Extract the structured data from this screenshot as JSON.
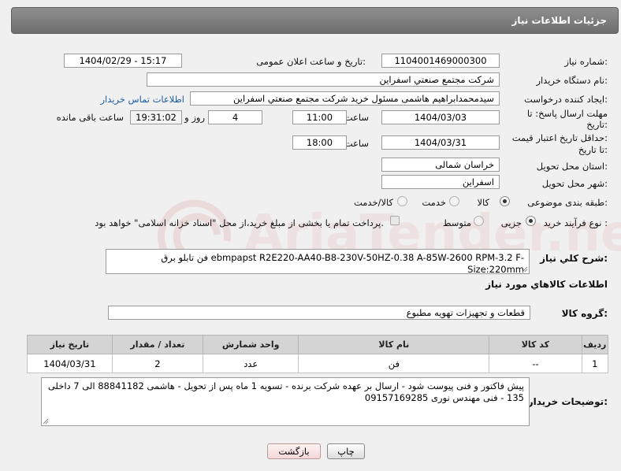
{
  "header": {
    "title": "جزئیات اطلاعات نیاز"
  },
  "need_number": {
    "label": "شماره نیاز:",
    "value": "1104001469000300"
  },
  "announce_datetime": {
    "label": "تاریخ و ساعت اعلان عمومی:",
    "value": "1404/02/29 - 15:17"
  },
  "buyer_org": {
    "label": "نام دستگاه خریدار:",
    "value": "شرکت مجتمع صنعتي اسفراين"
  },
  "requester": {
    "label": "ایجاد کننده درخواست:",
    "value": "سیدمحمدابراهیم هاشمی مسئول خرید شرکت مجتمع صنعتي اسفراين",
    "contact_link": "اطلاعات تماس خریدار"
  },
  "reply_deadline": {
    "label_line1": "مهلت ارسال پاسخ: تا",
    "label_line2": "تاریخ:",
    "date": "1404/03/03",
    "time_label": "ساعت",
    "time": "11:00",
    "days": "4",
    "days_label": "روز و",
    "remaining": "19:31:02",
    "remaining_label": "ساعت باقی مانده"
  },
  "price_validity": {
    "label_line1": "حداقل تاریخ اعتبار قیمت:",
    "label_line2": "تا تاریخ:",
    "date": "1404/03/31",
    "time_label": "ساعت",
    "time": "18:00"
  },
  "delivery_province": {
    "label": "استان محل تحویل:",
    "value": "خراسان شمالی"
  },
  "delivery_city": {
    "label": "شهر محل تحویل:",
    "value": "اسفراین"
  },
  "category": {
    "label": "طبقه بندی موضوعی:",
    "options": [
      "کالا",
      "خدمت",
      "کالا/خدمت"
    ],
    "selected": "کالا"
  },
  "purchase_process": {
    "label": "نوع فرآیند خرید :",
    "options": [
      "جزیی",
      "متوسط"
    ],
    "selected": "جزیی",
    "note": "پرداخت تمام یا بخشی از مبلغ خرید،از محل \"اسناد خزانه اسلامی\" خواهد بود."
  },
  "description": {
    "label": "شرح کلي نياز:",
    "value": "فن تابلو برق ebmpapst R2E220-AA40-B8-230V-50HZ-0.38 A-85W-2600 RPM-3.2 F-Size:220mm"
  },
  "goods_info": {
    "title": "اطلاعات کالاهاي مورد نياز"
  },
  "goods_group": {
    "label": "گروه کالا:",
    "value": "قطعات و تجهیزات تهویه مطبوع"
  },
  "table": {
    "headers": [
      "ردیف",
      "کد کالا",
      "نام کالا",
      "واحد شمارش",
      "تعداد / مقدار",
      "تاریخ نیاز"
    ],
    "rows": [
      [
        "1",
        "--",
        "فن",
        "عدد",
        "2",
        "1404/03/31"
      ]
    ]
  },
  "buyer_notes": {
    "label": "توضیحات خریدار:",
    "value": "پیش فاکتور و فنی پیوست شود - ارسال بر عهده شرکت برنده - تسویه 1 ماه پس از تحویل - هاشمی 88841182 الی 7 داخلی 135 - فنی مهندس نوری 09157169285"
  },
  "buttons": {
    "print": "چاپ",
    "back": "بازگشت"
  },
  "watermark": {
    "text": "AriaTender.net"
  }
}
